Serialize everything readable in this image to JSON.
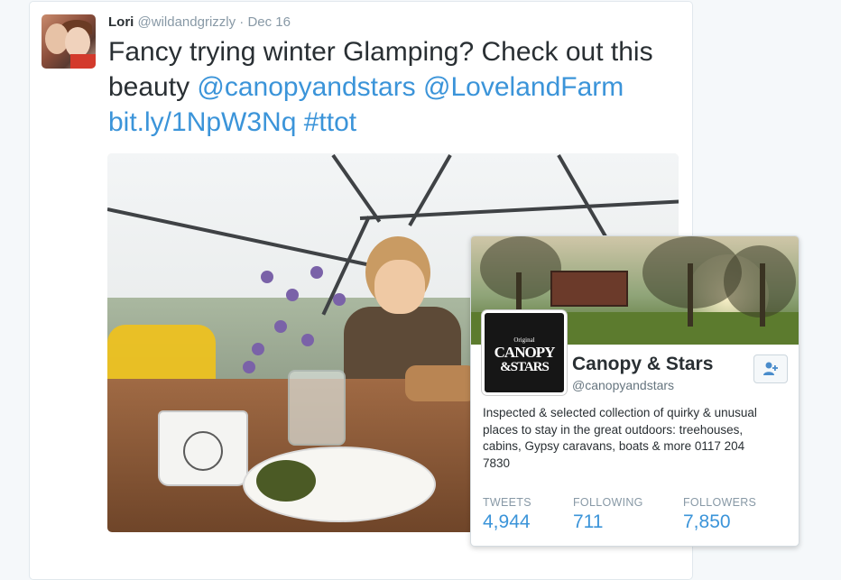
{
  "tweet": {
    "author_name": "Lori",
    "author_handle": "@wildandgrizzly",
    "separator": "·",
    "date": "Dec 16",
    "text_plain_1": "Fancy trying winter Glamping? Check out this beauty ",
    "mention_1": "@canopyandstars",
    "mention_2": "@LovelandFarm",
    "url": "bit.ly/1NpW3Nq",
    "hashtag": "#ttot",
    "avatar_icon": "profile-photo-icon",
    "media_icon": "photo-dome-breakfast"
  },
  "hovercard": {
    "logo_small": "Original",
    "logo_line_1": "CANOPY",
    "logo_line_2": "&STARS",
    "name": "Canopy & Stars",
    "handle": "@canopyandstars",
    "bio": "Inspected & selected collection of quirky & unusual places to stay in the great outdoors: treehouses, cabins, Gypsy caravans, boats & more 0117 204 7830",
    "follow_icon": "follow-user-plus-icon",
    "stats": {
      "tweets_label": "TWEETS",
      "tweets_value": "4,944",
      "following_label": "FOLLOWING",
      "following_value": "711",
      "followers_label": "FOLLOWERS",
      "followers_value": "7,850"
    }
  },
  "colors": {
    "link": "#3b94d9",
    "text": "#292f33",
    "muted": "#8899a6",
    "background": "#f5f8fa"
  }
}
